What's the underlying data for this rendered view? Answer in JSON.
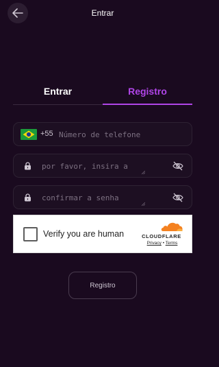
{
  "header": {
    "title": "Entrar",
    "back_icon": "arrow-left-icon"
  },
  "tabs": [
    {
      "label": "Entrar",
      "active": false
    },
    {
      "label": "Registro",
      "active": true
    }
  ],
  "form": {
    "phone": {
      "country_flag": "brazil-flag-icon",
      "dial_code": "+55",
      "value": "",
      "placeholder": "Número de telefone"
    },
    "password": {
      "value": "",
      "placeholder": "por favor, insira a",
      "icon": "lock-icon",
      "toggle_icon": "eye-off-icon"
    },
    "confirm_password": {
      "value": "",
      "placeholder": "confirmar a senha",
      "icon": "lock-icon",
      "toggle_icon": "eye-off-icon"
    }
  },
  "captcha": {
    "label": "Verify you are human",
    "checked": false,
    "brand": "CLOUDFLARE",
    "privacy_link": "Privacy",
    "separator": "•",
    "terms_link": "Terms"
  },
  "submit": {
    "label": "Registro"
  },
  "colors": {
    "background": "#1a0a1f",
    "accent": "#b045e8",
    "field_border": "#2e2233",
    "cloudflare_orange": "#f48120"
  }
}
